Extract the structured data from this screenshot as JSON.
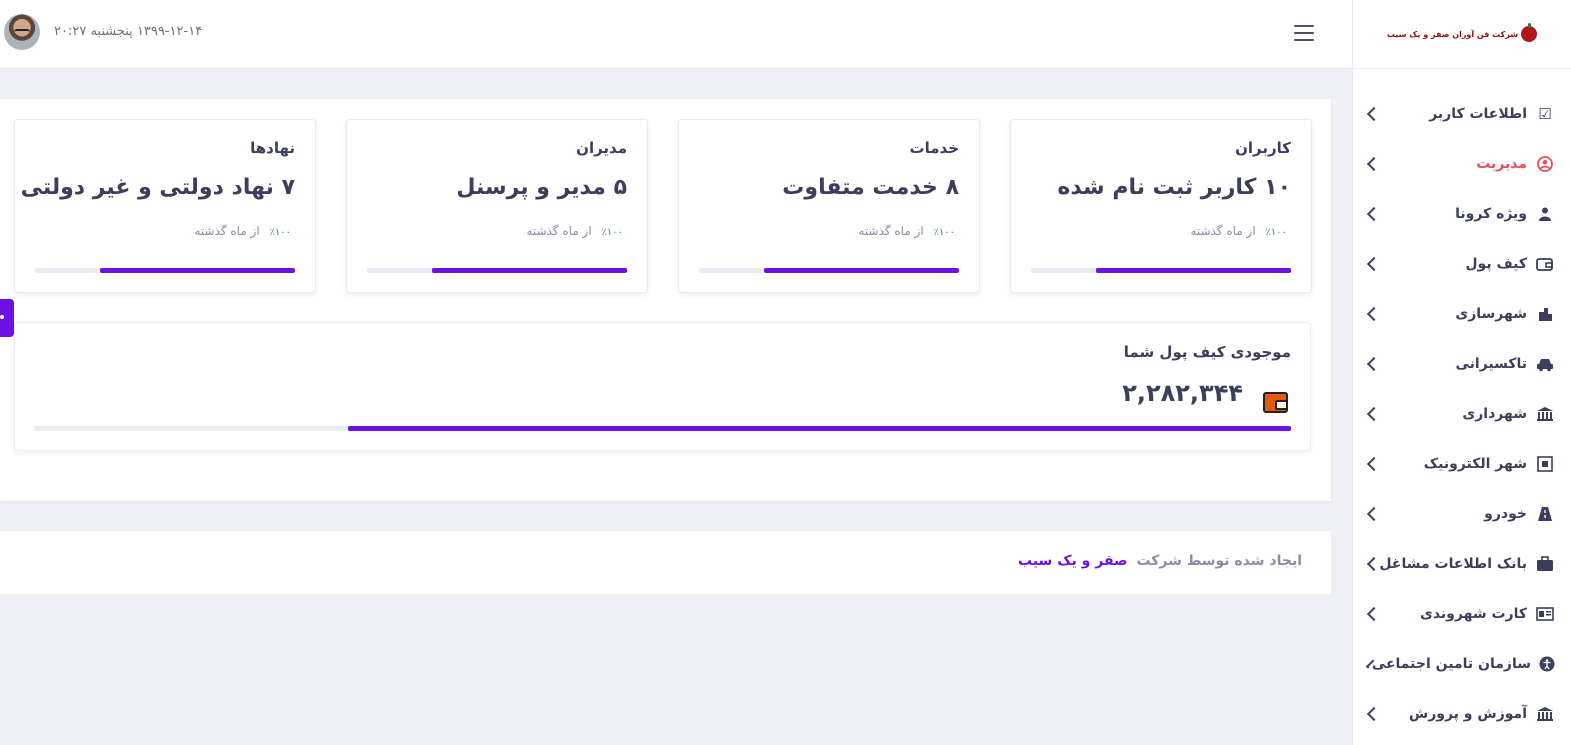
{
  "header": {
    "datetime": "۱۳۹۹-۱۲-۱۴ پنجشنبه ۲۰:۲۷"
  },
  "sidebar": {
    "logo_text": "شرکت فن آوران صفر و یک سیب",
    "items": [
      {
        "label": "اطلاعات کاربر",
        "icon": "checkbox-icon",
        "active": false
      },
      {
        "label": "مدیریت",
        "icon": "user-circle-icon",
        "active": true
      },
      {
        "label": "ویژه کرونا",
        "icon": "people-icon",
        "active": false
      },
      {
        "label": "کیف پول",
        "icon": "wallet-icon",
        "active": false
      },
      {
        "label": "شهرسازی",
        "icon": "city-icon",
        "active": false
      },
      {
        "label": "تاکسیرانی",
        "icon": "taxi-icon",
        "active": false
      },
      {
        "label": "شهرداری",
        "icon": "building-icon",
        "active": false
      },
      {
        "label": "شهر الکترونیک",
        "icon": "network-icon",
        "active": false
      },
      {
        "label": "خودرو",
        "icon": "road-icon",
        "active": false
      },
      {
        "label": "بانک اطلاعات مشاغل",
        "icon": "briefcase-icon",
        "active": false
      },
      {
        "label": "کارت شهروندی",
        "icon": "id-card-icon",
        "active": false
      },
      {
        "label": "سازمان تامین اجتماعی",
        "icon": "accessibility-icon",
        "active": false
      },
      {
        "label": "آموزش و پرورش",
        "icon": "institution-icon",
        "active": false
      }
    ]
  },
  "stats": [
    {
      "title": "کاربران",
      "value": "۱۰ کاربر ثبت نام شده",
      "trend_pct": "٪۱۰۰",
      "trend_label": "از ماه گذشته",
      "progress": 0.75
    },
    {
      "title": "خدمات",
      "value": "۸ خدمت متفاوت",
      "trend_pct": "٪۱۰۰",
      "trend_label": "از ماه گذشته",
      "progress": 0.75
    },
    {
      "title": "مدیران",
      "value": "۵ مدیر و پرسنل",
      "trend_pct": "٪۱۰۰",
      "trend_label": "از ماه گذشته",
      "progress": 0.75
    },
    {
      "title": "نهادها",
      "value": "۷ نهاد دولتی و غیر دولتی",
      "trend_pct": "٪۱۰۰",
      "trend_label": "از ماه گذشته",
      "progress": 0.75
    }
  ],
  "wallet": {
    "title": "موجودی کیف پول شما",
    "value": "۲,۲۸۲,۳۴۴",
    "progress": 0.75
  },
  "footer": {
    "text": "ایجاد شده توسط شرکت",
    "brand": "صفر و یک سیب"
  },
  "colors": {
    "accent": "#6c12e6",
    "active": "#e7515a",
    "trend": "#2e9e4f"
  }
}
